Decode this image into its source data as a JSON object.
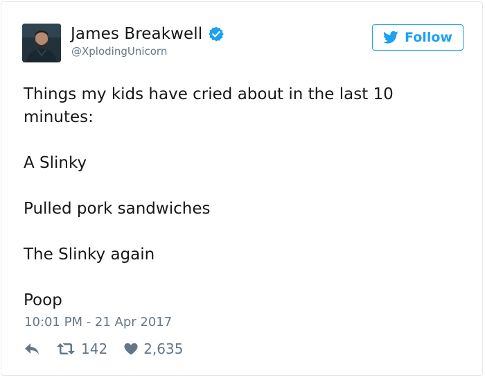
{
  "author": {
    "name": "James Breakwell",
    "handle": "@XplodingUnicorn",
    "verified": true
  },
  "follow_button": {
    "label": "Follow"
  },
  "tweet": {
    "paragraphs": [
      "Things my kids have cried about in the last 10 minutes:",
      "A Slinky",
      "Pulled pork sandwiches",
      "The Slinky again",
      "Poop"
    ],
    "timestamp": "10:01 PM - 21 Apr 2017"
  },
  "stats": {
    "retweets": "142",
    "likes": "2,635"
  },
  "icons": {
    "verified": "verified-badge-icon",
    "follow": "twitter-bird-icon",
    "reply": "reply-icon",
    "retweet": "retweet-icon",
    "like": "heart-icon"
  },
  "colors": {
    "brand": "#1da1f2",
    "text": "#14171a",
    "muted": "#657786",
    "border": "#e1e8ed"
  }
}
